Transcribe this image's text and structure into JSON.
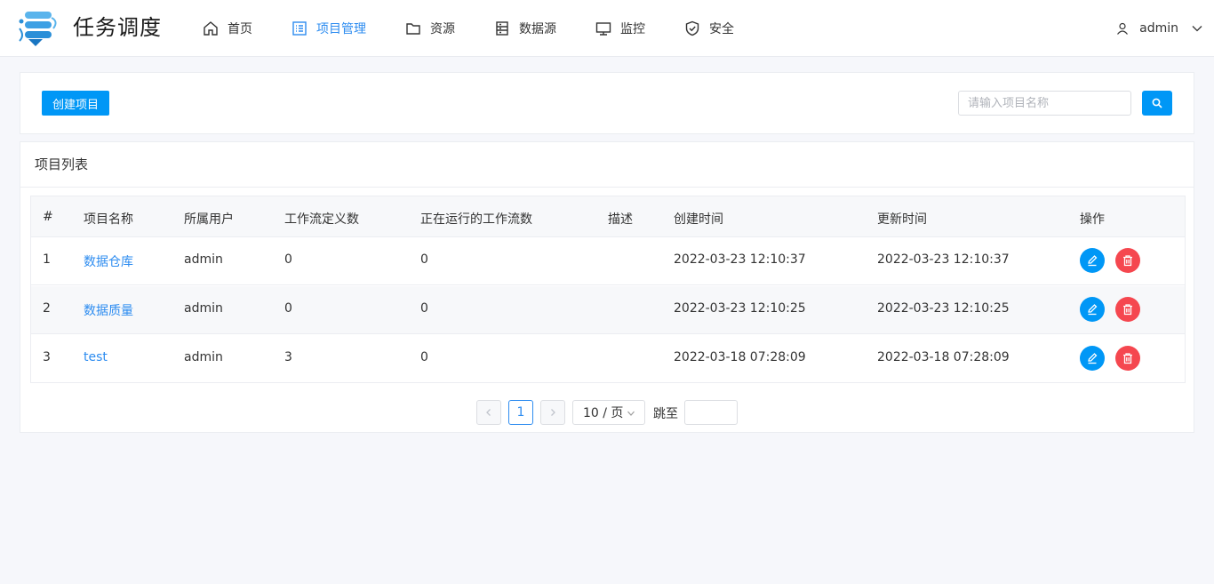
{
  "app": {
    "title": "任务调度"
  },
  "nav": [
    {
      "label": "首页",
      "icon": "home-icon"
    },
    {
      "label": "项目管理",
      "icon": "project-list-icon",
      "active": true
    },
    {
      "label": "资源",
      "icon": "folder-icon"
    },
    {
      "label": "数据源",
      "icon": "database-icon"
    },
    {
      "label": "监控",
      "icon": "monitor-icon"
    },
    {
      "label": "安全",
      "icon": "shield-icon"
    }
  ],
  "user": {
    "name": "admin"
  },
  "toolbar": {
    "create_label": "创建项目",
    "search_placeholder": "请输入项目名称"
  },
  "list": {
    "title": "项目列表",
    "columns": [
      "#",
      "项目名称",
      "所属用户",
      "工作流定义数",
      "正在运行的工作流数",
      "描述",
      "创建时间",
      "更新时间",
      "操作"
    ],
    "rows": [
      {
        "index": "1",
        "name": "数据仓库",
        "owner": "admin",
        "defs": "0",
        "running": "0",
        "desc": "",
        "created": "2022-03-23 12:10:37",
        "updated": "2022-03-23 12:10:37"
      },
      {
        "index": "2",
        "name": "数据质量",
        "owner": "admin",
        "defs": "0",
        "running": "0",
        "desc": "",
        "created": "2022-03-23 12:10:25",
        "updated": "2022-03-23 12:10:25"
      },
      {
        "index": "3",
        "name": "test",
        "owner": "admin",
        "defs": "3",
        "running": "0",
        "desc": "",
        "created": "2022-03-18 07:28:09",
        "updated": "2022-03-18 07:28:09"
      }
    ]
  },
  "pagination": {
    "current_page": "1",
    "page_size": "10 / 页",
    "jump_label": "跳至"
  },
  "colors": {
    "accent": "#0097f6",
    "link": "#2d8cf0",
    "danger": "#f5474f"
  }
}
